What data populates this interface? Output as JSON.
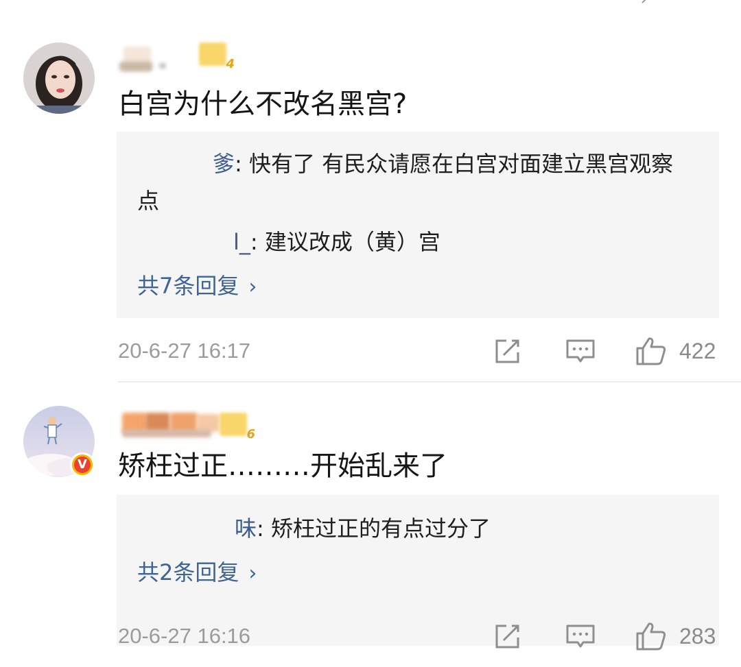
{
  "comments": [
    {
      "username_hidden": "",
      "level": "4",
      "text": "白宫为什么不改名黑宫?",
      "replies": [
        {
          "name": "爹",
          "text": "快有了 有民众请愿在白宫对面建立黑宫观察点"
        },
        {
          "name": "l_",
          "text": "建议改成（黄）宫"
        }
      ],
      "more_replies": "共7条回复",
      "time": "20-6-27 16:17",
      "likes": "422"
    },
    {
      "level": "6",
      "verified_badge": "V",
      "text": "矫枉过正………开始乱来了",
      "replies": [
        {
          "name": "味",
          "text": "矫枉过正的有点过分了"
        }
      ],
      "more_replies": "共2条回复",
      "time": "20-6-27 16:16",
      "likes": "283"
    }
  ],
  "icons": {
    "share": "share-icon",
    "comment": "comment-icon",
    "like": "thumbs-up-icon"
  },
  "colors": {
    "link": "#3e6496",
    "reply_bg": "#f5f5f5",
    "meta": "#9b9b9b"
  }
}
